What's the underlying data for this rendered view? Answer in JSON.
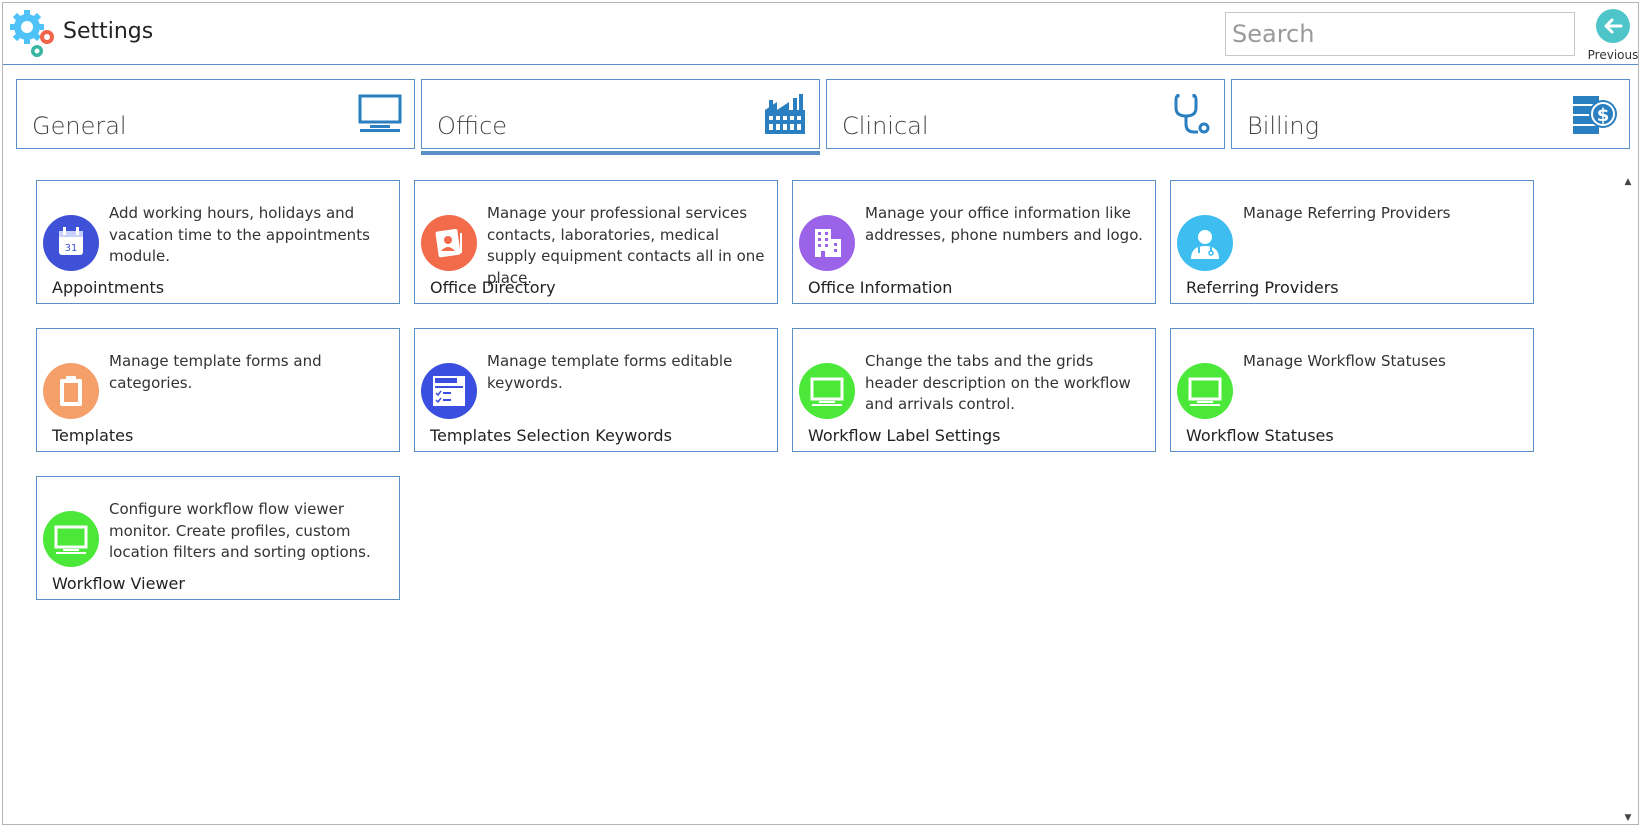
{
  "header": {
    "title": "Settings",
    "search_placeholder": "Search",
    "previous_label": "Previous"
  },
  "tabs": [
    {
      "label": "General",
      "icon": "monitor-icon",
      "active": false
    },
    {
      "label": "Office",
      "icon": "factory-icon",
      "active": true
    },
    {
      "label": "Clinical",
      "icon": "stethoscope-icon",
      "active": false
    },
    {
      "label": "Billing",
      "icon": "billing-dollar-icon",
      "active": false
    }
  ],
  "tiles": [
    {
      "title": "Appointments",
      "description": "Add working hours, holidays and vacation time to the appointments module.",
      "icon": "calendar-icon",
      "color": "#3f51d6"
    },
    {
      "title": "Office Directory",
      "description": "Manage your professional services contacts, laboratories, medical supply equipment contacts all in one place.",
      "icon": "contact-card-icon",
      "color": "#f26b4a"
    },
    {
      "title": "Office Information",
      "description": "Manage your office information like addresses, phone numbers and logo.",
      "icon": "building-icon",
      "color": "#9b63e8"
    },
    {
      "title": "Referring Providers",
      "description": "Manage Referring Providers",
      "icon": "doctor-icon",
      "color": "#3ebdf0"
    },
    {
      "title": "Templates",
      "description": "Manage template forms and categories.",
      "icon": "clipboard-icon",
      "color": "#f5a06a"
    },
    {
      "title": "Templates Selection Keywords",
      "description": "Manage template forms editable keywords.",
      "icon": "form-checklist-icon",
      "color": "#3a4fe0"
    },
    {
      "title": "Workflow Label Settings",
      "description": "Change the tabs and the grids header description on the workflow and arrivals control.",
      "icon": "monitor-icon",
      "color": "#4be83a"
    },
    {
      "title": "Workflow Statuses",
      "description": "Manage Workflow Statuses",
      "icon": "monitor-icon",
      "color": "#4be83a"
    },
    {
      "title": "Workflow Viewer",
      "description": "Configure workflow flow viewer monitor. Create profiles, custom location filters and sorting options.",
      "icon": "monitor-icon",
      "color": "#4be83a"
    }
  ],
  "colors": {
    "accent": "#5b8fc7",
    "previous_button": "#4ec5c9"
  }
}
